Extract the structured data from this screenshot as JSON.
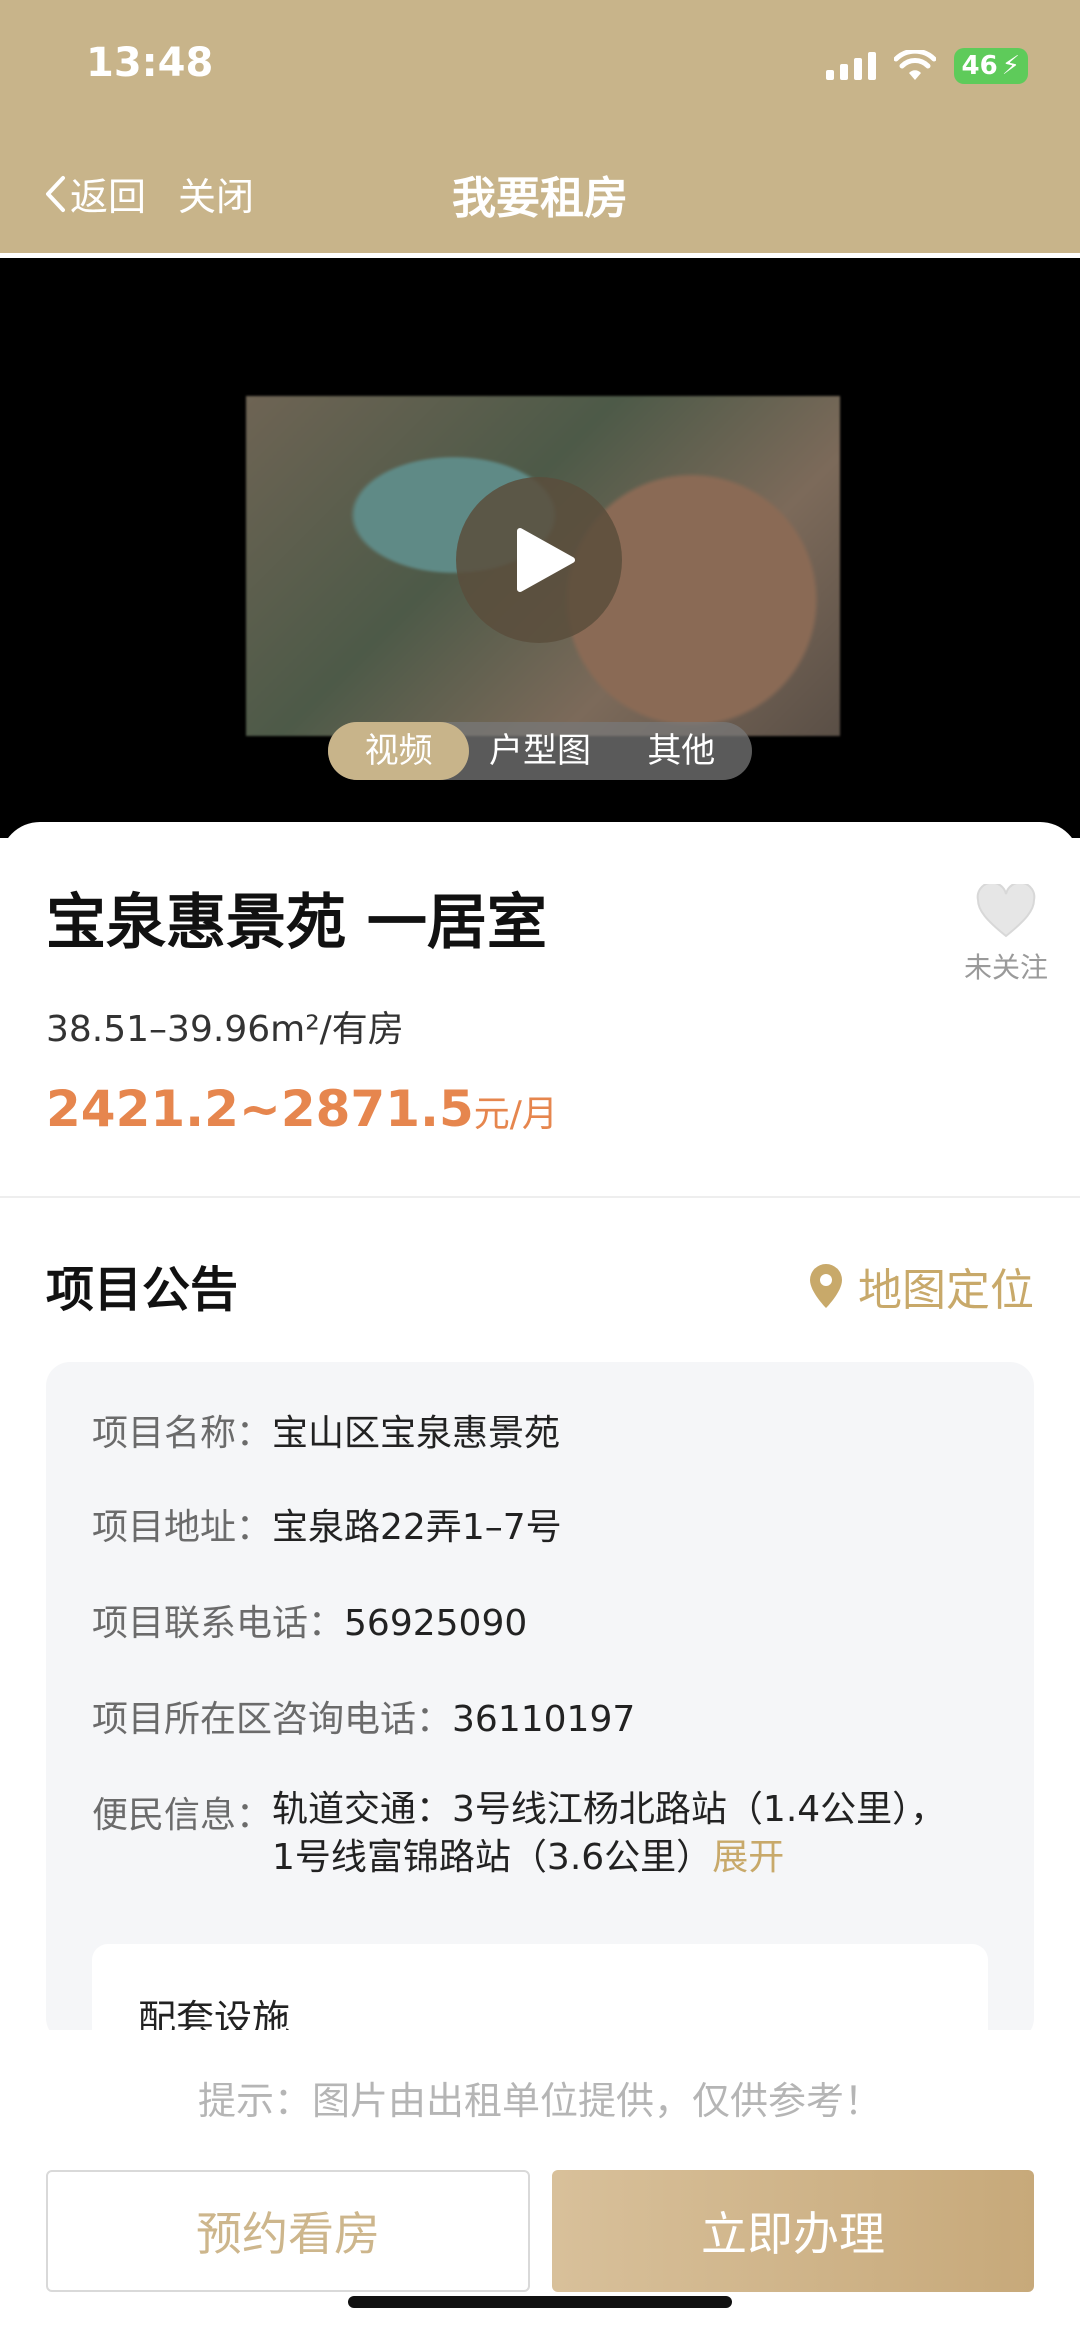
{
  "status_bar": {
    "time": "13:48",
    "battery": "46"
  },
  "nav": {
    "back": "返回",
    "close": "关闭",
    "title": "我要租房"
  },
  "media": {
    "tabs": [
      "视频",
      "户型图",
      "其他"
    ],
    "active_tab": "视频"
  },
  "listing": {
    "title": "宝泉惠景苑 一居室",
    "area": "38.51–39.96m²/有房",
    "price": "2421.2~2871.5",
    "price_unit": "元/月",
    "favorite_label": "未关注"
  },
  "section": {
    "title": "项目公告",
    "map_link": "地图定位",
    "rows": [
      {
        "key": "项目名称：",
        "value": "宝山区宝泉惠景苑"
      },
      {
        "key": "项目地址：",
        "value": "宝泉路22弄1–7号"
      },
      {
        "key": "项目联系电话：",
        "value": "56925090"
      },
      {
        "key": "项目所在区咨询电话：",
        "value": "36110197"
      },
      {
        "key": "便民信息：",
        "value": "轨道交通：3号线江杨北路站（1.4公里），1号线富锦路站（3.6公里）",
        "expand": "展开"
      }
    ],
    "facility_title": "配套设施"
  },
  "footer": {
    "tip": "提示：图片由出租单位提供，仅供参考！",
    "reserve_button": "预约看房",
    "apply_button": "立即办理"
  },
  "colors": {
    "header": "#c8b48a",
    "accent": "#c8a96a",
    "price": "#e6864e"
  }
}
